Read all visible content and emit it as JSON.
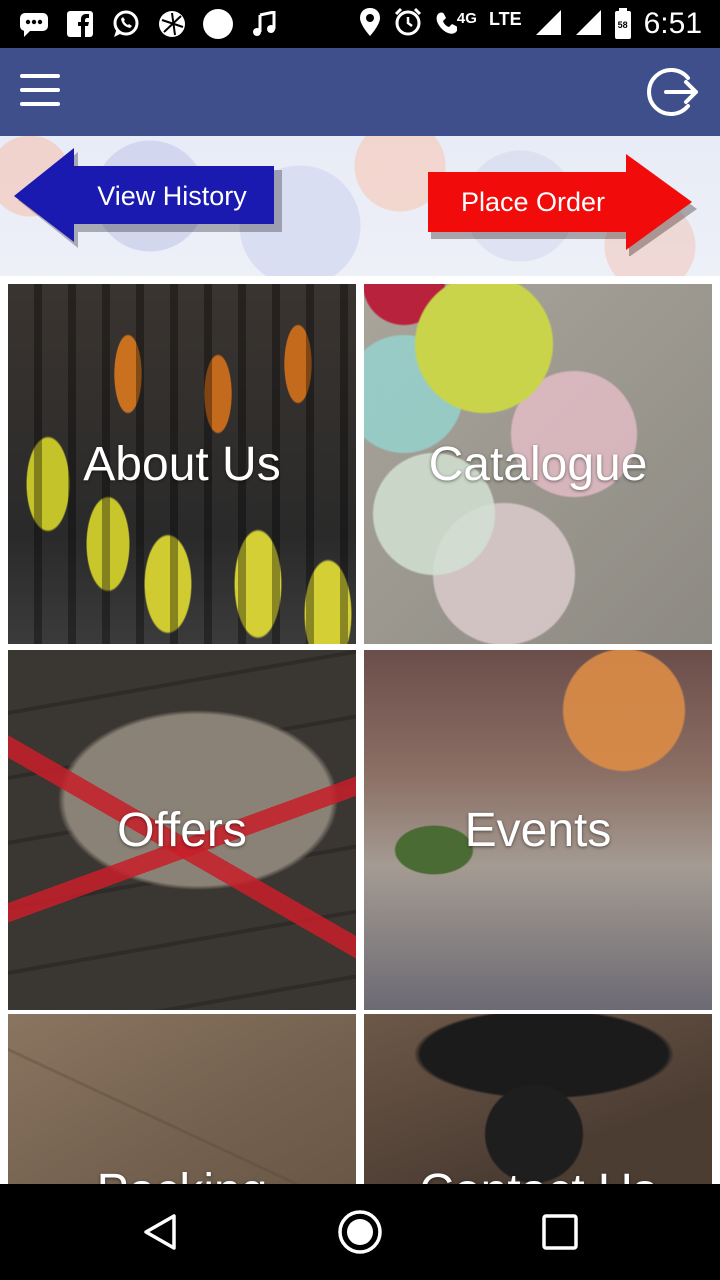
{
  "status_bar": {
    "network_label": "4G",
    "lte_label": "LTE",
    "battery_level": "58",
    "time": "6:51",
    "icons": [
      "messages-icon",
      "facebook-icon",
      "whatsapp-icon",
      "app-icon",
      "circle-icon",
      "music-icon",
      "location-icon",
      "alarm-icon",
      "wifi-calling-icon",
      "signal-icon",
      "signal-icon-2",
      "battery-icon"
    ]
  },
  "app_bar": {
    "menu_icon": "menu-icon",
    "logout_icon": "logout-icon"
  },
  "banner": {
    "view_history_label": "View History",
    "place_order_label": "Place Order",
    "view_history_color": "#1a1ab0",
    "place_order_color": "#f20b0b"
  },
  "tiles": [
    {
      "label": "About Us"
    },
    {
      "label": "Catalogue"
    },
    {
      "label": "Offers"
    },
    {
      "label": "Events"
    },
    {
      "label": "Packing"
    },
    {
      "label": "Contact Us"
    }
  ],
  "nav_bar": {
    "back_icon": "back-icon",
    "home_icon": "home-icon",
    "recents_icon": "recents-icon"
  },
  "colors": {
    "app_bar": "#3e4f8c",
    "status_bar": "#000000"
  }
}
